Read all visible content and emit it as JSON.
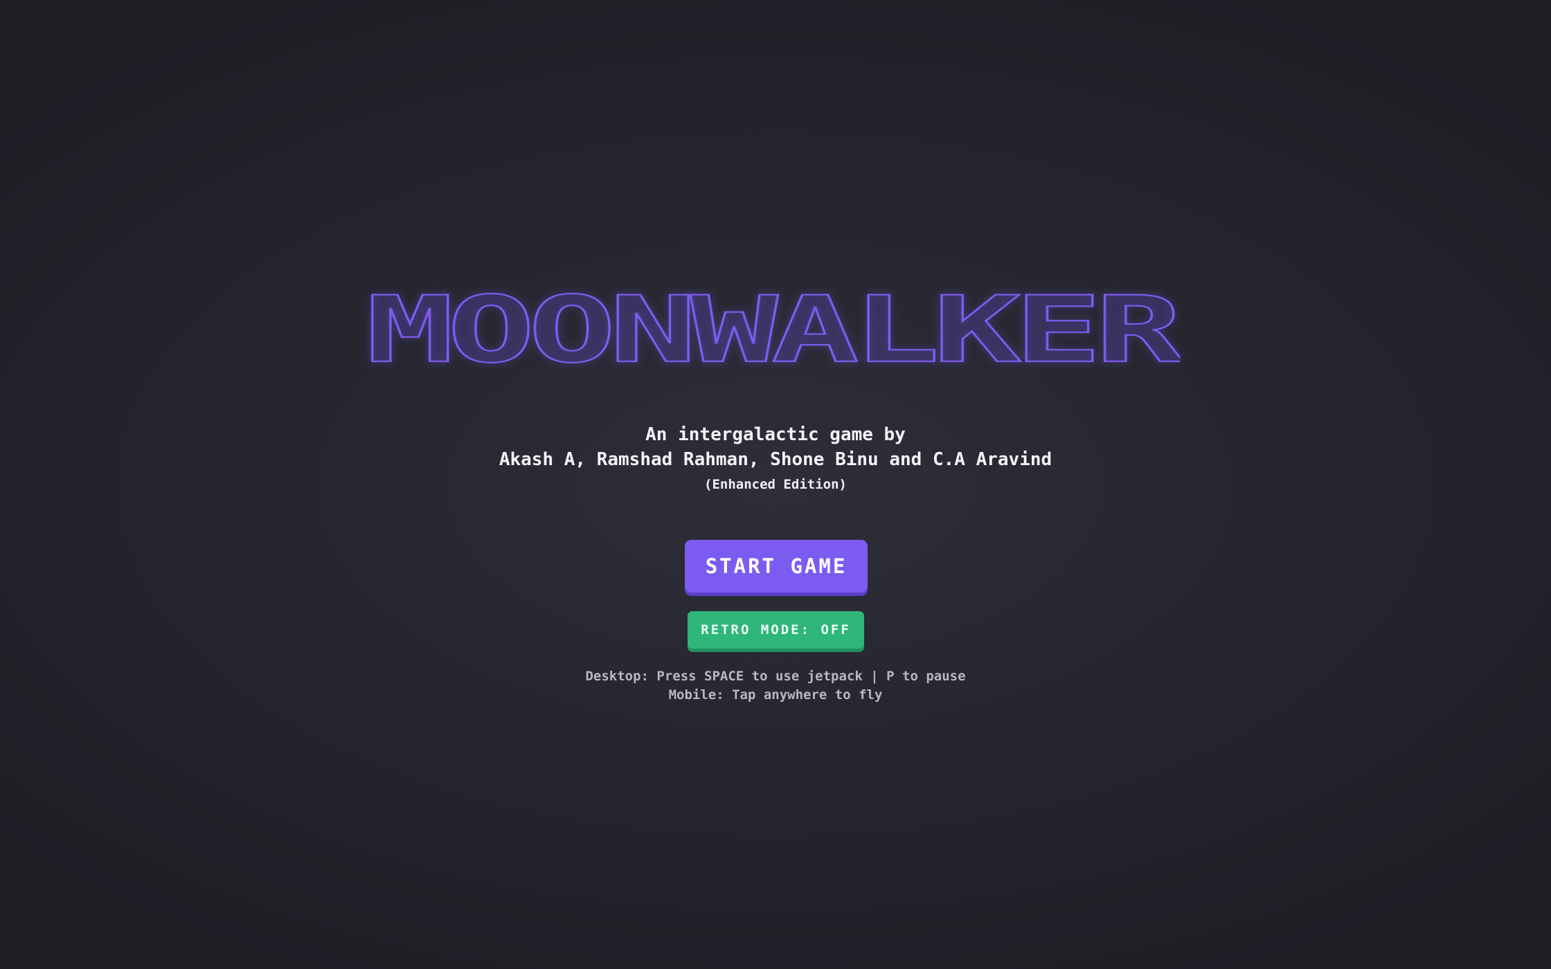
{
  "game": {
    "title": "MOONWALKER",
    "accent_color": "#7c5cf0",
    "secondary_color": "#2fb67a",
    "background_color": "#2a2a33"
  },
  "credits": {
    "line1": "An intergalactic game by",
    "line2": "Akash A, Ramshad Rahman, Shone Binu and C.A Aravind",
    "line3": "(Enhanced Edition)"
  },
  "menu": {
    "start_label": "START GAME",
    "retro_label": "RETRO MODE: OFF"
  },
  "instructions": {
    "desktop": "Desktop: Press SPACE to use jetpack | P to pause",
    "mobile": "Mobile: Tap anywhere to fly"
  }
}
